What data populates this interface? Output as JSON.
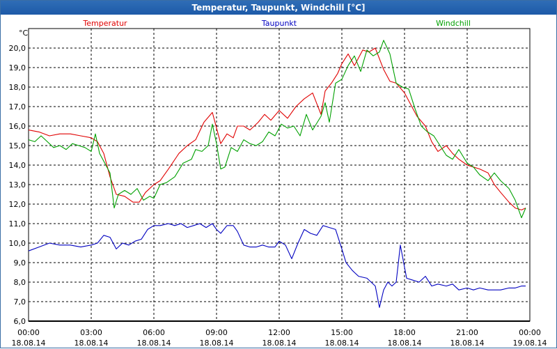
{
  "window": {
    "title": "Temperatur, Taupunkt, Windchill [°C]"
  },
  "colors": {
    "temperatur": "#e00000",
    "taupunkt": "#0000c0",
    "windchill": "#00a000",
    "grid": "#000000"
  },
  "chart_data": {
    "type": "line",
    "title": "Temperatur, Taupunkt, Windchill [°C]",
    "ylabel": "°C",
    "ylim": [
      6.0,
      20.5
    ],
    "y_ticks": [
      "6,0",
      "7,0",
      "8,0",
      "9,0",
      "10,0",
      "11,0",
      "12,0",
      "13,0",
      "14,0",
      "15,0",
      "16,0",
      "17,0",
      "18,0",
      "19,0",
      "20,0"
    ],
    "x_ticks": [
      {
        "time": "00:00",
        "date": "18.08.14"
      },
      {
        "time": "03:00",
        "date": "18.08.14"
      },
      {
        "time": "06:00",
        "date": "18.08.14"
      },
      {
        "time": "09:00",
        "date": "18.08.14"
      },
      {
        "time": "12:00",
        "date": "18.08.14"
      },
      {
        "time": "15:00",
        "date": "18.08.14"
      },
      {
        "time": "18:00",
        "date": "18.08.14"
      },
      {
        "time": "21:00",
        "date": "18.08.14"
      },
      {
        "time": "00:00",
        "date": "19.08.14"
      }
    ],
    "x_unit": "hours since 18.08.14 00:00",
    "xlim": [
      0,
      24
    ],
    "grid": true,
    "legend_placement": "top",
    "series": [
      {
        "name": "Temperatur",
        "color": "#e00000",
        "x": [
          0,
          0.5,
          1,
          1.5,
          2,
          2.5,
          3,
          3.3,
          3.6,
          3.9,
          4.2,
          4.6,
          5,
          5.3,
          5.6,
          6,
          6.3,
          6.7,
          7.2,
          7.6,
          8,
          8.4,
          8.8,
          9,
          9.2,
          9.5,
          9.8,
          10,
          10.3,
          10.6,
          11,
          11.3,
          11.6,
          12,
          12.4,
          12.8,
          13.2,
          13.6,
          14,
          14.2,
          14.5,
          14.8,
          15,
          15.3,
          15.6,
          16,
          16.3,
          16.6,
          17,
          17.3,
          17.6,
          18,
          18.3,
          18.6,
          19,
          19.3,
          19.6,
          20,
          20.3,
          20.6,
          21,
          21.3,
          21.6,
          22,
          22.3,
          22.6,
          23,
          23.3,
          23.6,
          23.8
        ],
        "values": [
          15.8,
          15.7,
          15.5,
          15.6,
          15.6,
          15.5,
          15.4,
          15.2,
          14.6,
          13.4,
          12.5,
          12.4,
          12.1,
          12.1,
          12.6,
          13.0,
          13.2,
          13.8,
          14.6,
          15.0,
          15.3,
          16.2,
          16.7,
          15.9,
          15.1,
          15.6,
          15.4,
          16.0,
          16.0,
          15.8,
          16.2,
          16.6,
          16.3,
          16.8,
          16.4,
          17.0,
          17.4,
          17.7,
          16.6,
          17.8,
          18.2,
          18.7,
          19.2,
          19.7,
          19.1,
          19.9,
          19.8,
          20.0,
          18.9,
          18.3,
          18.2,
          17.7,
          17.1,
          16.5,
          16.0,
          15.2,
          14.7,
          15.0,
          14.6,
          14.3,
          14.0,
          13.9,
          13.8,
          13.6,
          13.0,
          12.6,
          12.1,
          11.8,
          11.7,
          11.8
        ]
      },
      {
        "name": "Taupunkt",
        "color": "#0000c0",
        "x": [
          0,
          0.5,
          1,
          1.5,
          2,
          2.5,
          3,
          3.3,
          3.6,
          3.9,
          4.2,
          4.5,
          4.8,
          5.1,
          5.4,
          5.7,
          6,
          6.3,
          6.7,
          7,
          7.3,
          7.6,
          7.9,
          8.2,
          8.5,
          8.8,
          9,
          9.2,
          9.5,
          9.8,
          10,
          10.3,
          10.6,
          10.9,
          11.2,
          11.5,
          11.8,
          12,
          12.3,
          12.6,
          12.9,
          13.2,
          13.5,
          13.8,
          14.1,
          14.4,
          14.7,
          15,
          15.2,
          15.5,
          15.8,
          16.2,
          16.6,
          16.8,
          17,
          17.2,
          17.4,
          17.6,
          17.8,
          18.1,
          18.4,
          18.7,
          19,
          19.3,
          19.6,
          20,
          20.3,
          20.6,
          21,
          21.3,
          21.6,
          22,
          22.3,
          22.6,
          23,
          23.3,
          23.6,
          23.8
        ],
        "values": [
          9.6,
          9.8,
          10.0,
          9.9,
          9.9,
          9.8,
          9.9,
          10.0,
          10.4,
          10.3,
          9.7,
          10.0,
          9.9,
          10.1,
          10.2,
          10.7,
          10.9,
          10.9,
          11.0,
          10.9,
          11.0,
          10.8,
          10.9,
          11.0,
          10.8,
          11.0,
          10.7,
          10.5,
          10.9,
          10.9,
          10.6,
          9.9,
          9.8,
          9.8,
          9.9,
          9.8,
          9.8,
          10.1,
          9.9,
          9.2,
          10.0,
          10.7,
          10.5,
          10.4,
          10.9,
          10.8,
          10.7,
          9.7,
          9.0,
          8.6,
          8.3,
          8.2,
          7.8,
          6.7,
          7.6,
          8.0,
          7.8,
          8.0,
          9.9,
          8.2,
          8.1,
          8.0,
          8.3,
          7.8,
          7.9,
          7.8,
          7.9,
          7.6,
          7.7,
          7.6,
          7.7,
          7.6,
          7.6,
          7.6,
          7.7,
          7.7,
          7.8,
          7.8
        ]
      },
      {
        "name": "Windchill",
        "color": "#00a000",
        "x": [
          0,
          0.3,
          0.6,
          0.9,
          1.2,
          1.5,
          1.8,
          2.1,
          2.4,
          2.7,
          3,
          3.2,
          3.4,
          3.6,
          3.9,
          4.1,
          4.3,
          4.6,
          4.9,
          5.2,
          5.5,
          5.8,
          6,
          6.3,
          6.6,
          7,
          7.4,
          7.8,
          8,
          8.3,
          8.6,
          8.8,
          9,
          9.2,
          9.4,
          9.7,
          10,
          10.3,
          10.6,
          10.9,
          11.2,
          11.5,
          11.8,
          12.1,
          12.4,
          12.7,
          13,
          13.3,
          13.6,
          14,
          14.2,
          14.4,
          14.7,
          15,
          15.3,
          15.6,
          15.9,
          16.2,
          16.5,
          16.8,
          17,
          17.3,
          17.6,
          17.9,
          18.2,
          18.5,
          18.8,
          19.1,
          19.4,
          19.7,
          20,
          20.3,
          20.6,
          21,
          21.3,
          21.6,
          22,
          22.3,
          22.6,
          23,
          23.3,
          23.6,
          23.8
        ],
        "values": [
          15.3,
          15.2,
          15.5,
          15.2,
          14.9,
          15.0,
          14.8,
          15.1,
          15.0,
          14.9,
          14.7,
          15.6,
          14.6,
          14.2,
          13.6,
          11.8,
          12.5,
          12.7,
          12.5,
          12.8,
          12.2,
          12.4,
          12.3,
          13.0,
          13.1,
          13.4,
          14.1,
          14.3,
          14.8,
          14.7,
          15.0,
          16.1,
          15.1,
          13.8,
          13.9,
          14.9,
          14.7,
          15.3,
          15.1,
          15.0,
          15.2,
          15.7,
          15.5,
          16.1,
          15.9,
          16.0,
          15.5,
          16.6,
          15.8,
          16.5,
          17.2,
          16.2,
          18.2,
          18.4,
          19.1,
          19.6,
          18.8,
          19.9,
          19.6,
          19.8,
          20.4,
          19.7,
          18.2,
          18.0,
          17.9,
          16.9,
          16.0,
          15.7,
          15.5,
          15.0,
          14.5,
          14.3,
          14.8,
          14.1,
          13.9,
          13.5,
          13.2,
          13.6,
          13.2,
          12.8,
          12.2,
          11.3,
          11.8
        ]
      }
    ]
  }
}
